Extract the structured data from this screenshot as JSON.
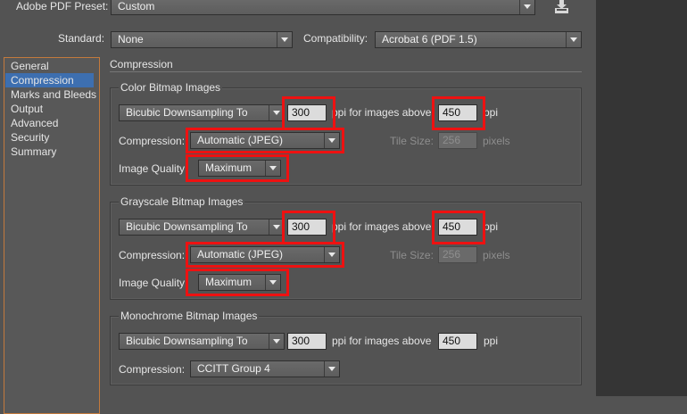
{
  "preset": {
    "label": "Adobe PDF Preset:",
    "value": "Custom",
    "save_icon": "save-preset-icon"
  },
  "standard": {
    "label": "Standard:",
    "value": "None"
  },
  "compatibility": {
    "label": "Compatibility:",
    "value": "Acrobat 6 (PDF 1.5)"
  },
  "sidebar": {
    "items": [
      {
        "label": "General"
      },
      {
        "label": "Compression"
      },
      {
        "label": "Marks and Bleeds"
      },
      {
        "label": "Output"
      },
      {
        "label": "Advanced"
      },
      {
        "label": "Security"
      },
      {
        "label": "Summary"
      }
    ],
    "selected_index": 1
  },
  "section_title": "Compression",
  "color": {
    "title": "Color Bitmap Images",
    "downsampling": "Bicubic Downsampling To",
    "ppi": "300",
    "ppi_label": "ppi for images above",
    "above": "450",
    "above_unit": "ppi",
    "compression_label": "Compression:",
    "compression": "Automatic (JPEG)",
    "tile_label": "Tile Size:",
    "tile": "256",
    "tile_unit": "pixels",
    "quality_label": "Image Quality:",
    "quality": "Maximum"
  },
  "gray": {
    "title": "Grayscale Bitmap Images",
    "downsampling": "Bicubic Downsampling To",
    "ppi": "300",
    "ppi_label": "ppi for images above",
    "above": "450",
    "above_unit": "ppi",
    "compression_label": "Compression:",
    "compression": "Automatic (JPEG)",
    "tile_label": "Tile Size:",
    "tile": "256",
    "tile_unit": "pixels",
    "quality_label": "Image Quality:",
    "quality": "Maximum"
  },
  "mono": {
    "title": "Monochrome Bitmap Images",
    "downsampling": "Bicubic Downsampling To",
    "ppi": "300",
    "ppi_label": "ppi for images above",
    "above": "450",
    "above_unit": "ppi",
    "compression_label": "Compression:",
    "compression": "CCITT Group 4"
  },
  "colors": {
    "highlight": "#ee1111",
    "selection": "#3d6fb0",
    "panel": "#535353",
    "sidebar_border": "#c37a3d"
  }
}
